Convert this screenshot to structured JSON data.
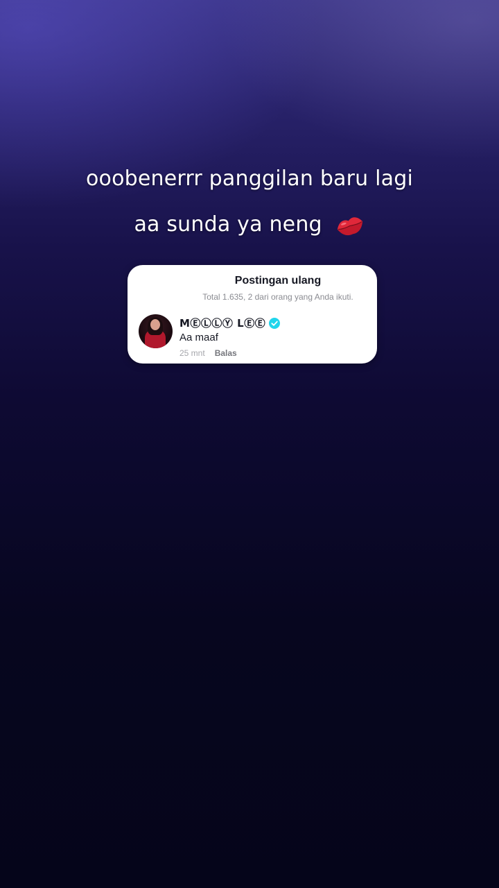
{
  "caption": {
    "line1": "ooobenerrr  panggilan baru lagi",
    "line2": "aa sunda ya neng",
    "emoji_icon": "lips-kiss-icon"
  },
  "card": {
    "title": "Postingan ulang",
    "subtitle": "Total 1.635, 2 dari orang yang Anda ikuti.",
    "comment": {
      "username": "MⒺⓁⓁⓎ LⒺⒺ",
      "verified": true,
      "text": "Aa maaf",
      "time": "25 mnt",
      "reply_label": "Balas"
    }
  },
  "colors": {
    "verified": "#20d5ec",
    "lips": "#e0283a"
  }
}
